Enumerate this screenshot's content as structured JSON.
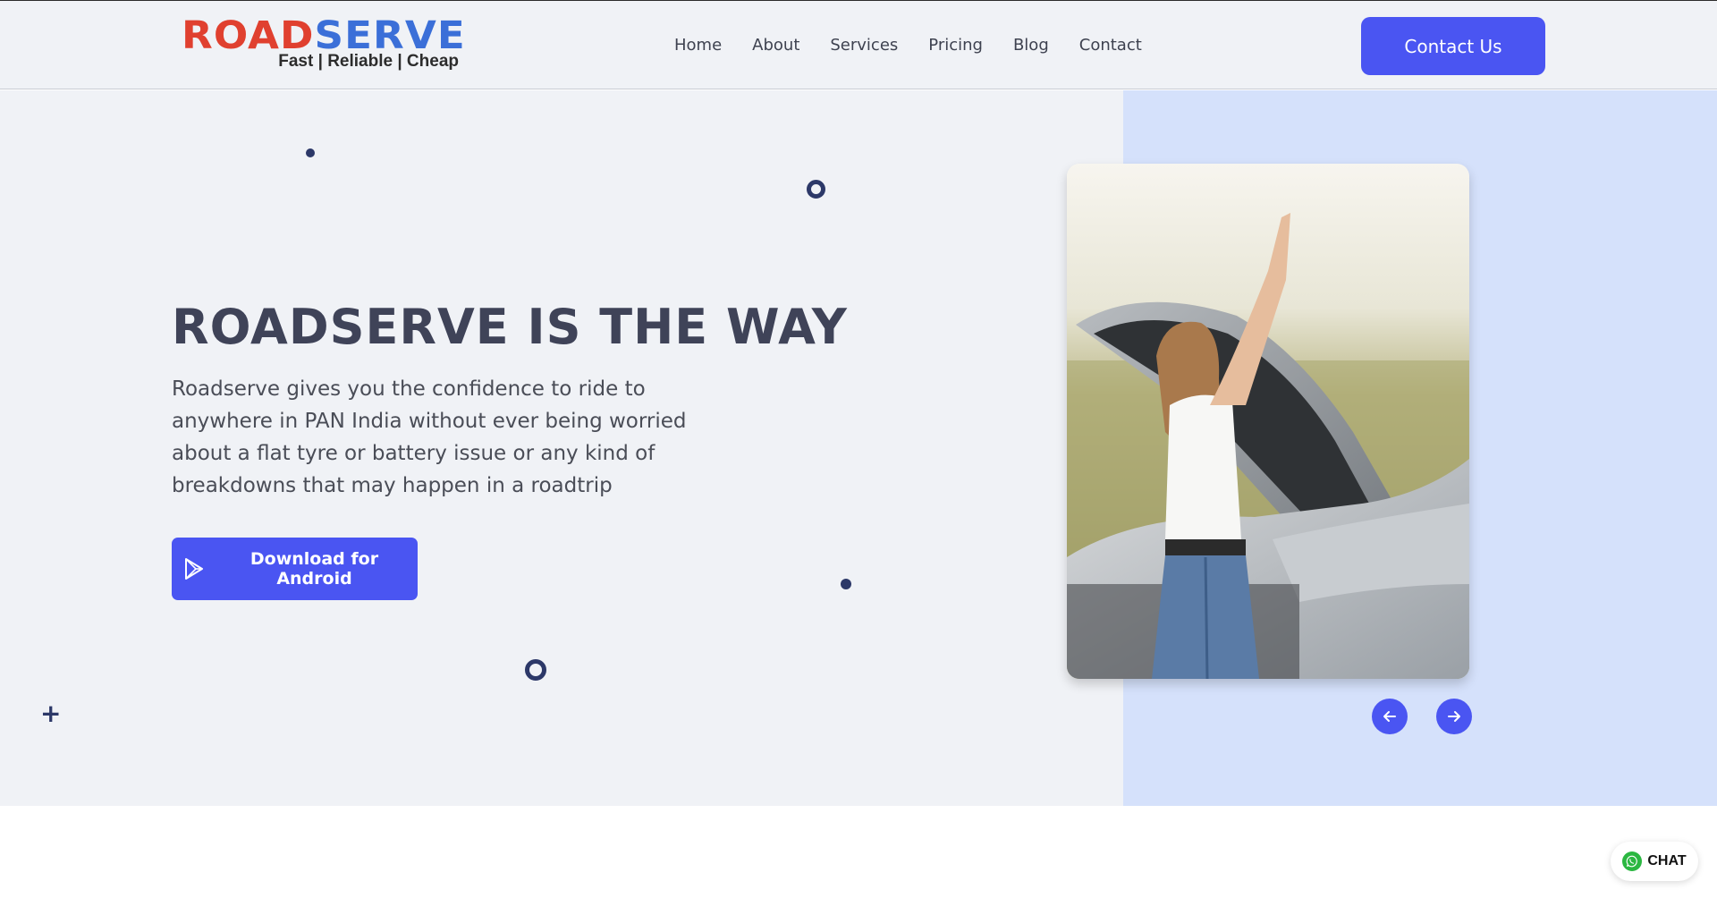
{
  "header": {
    "logo": {
      "road": "ROAD",
      "serve": "SERVE",
      "tagline": "Fast | Reliable | Cheap"
    },
    "nav": [
      "Home",
      "About",
      "Services",
      "Pricing",
      "Blog",
      "Contact"
    ],
    "cta_label": "Contact Us"
  },
  "hero": {
    "title": "ROADSERVE IS THE WAY",
    "description": "Roadserve gives you the confidence to ride to anywhere in PAN India without ever being worried about a flat tyre or battery issue or any kind of breakdowns that may happen in a roadtrip",
    "download_label": "Download for Android",
    "download_icon": "play-store-icon",
    "photo_icon": "hero-photo",
    "prev_icon": "arrow-left-icon",
    "next_icon": "arrow-right-icon"
  },
  "chat": {
    "label": "CHAT",
    "icon": "whatsapp-icon"
  },
  "colors": {
    "accent": "#4a55f2",
    "logo_red": "#e0402f",
    "logo_blue": "#3b6fd8",
    "hero_bg": "#f0f2f6",
    "hero_panel": "#d5e1fb",
    "title_color": "#3f4358",
    "decor": "#2c3868"
  }
}
